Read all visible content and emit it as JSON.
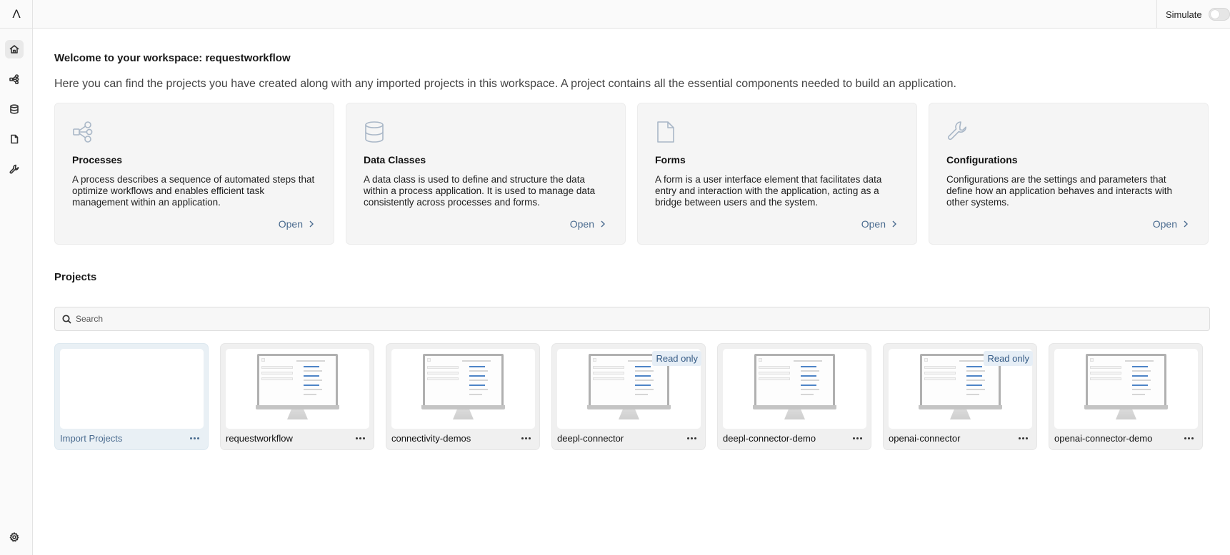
{
  "app": {
    "logo": "Λ"
  },
  "topbar": {
    "simulate_label": "Simulate",
    "simulate_on": false
  },
  "sidebar": {
    "items": [
      {
        "icon": "home-icon",
        "active": true
      },
      {
        "icon": "process-icon",
        "active": false
      },
      {
        "icon": "database-icon",
        "active": false
      },
      {
        "icon": "file-icon",
        "active": false
      },
      {
        "icon": "wrench-icon",
        "active": false
      }
    ],
    "settings_icon": "gear-icon"
  },
  "main": {
    "welcome": "Welcome to your workspace: requestworkflow",
    "intro": "Here you can find the projects you have created along with any imported projects in this workspace. A project contains all the essential components needed to build an application.",
    "cards": [
      {
        "icon": "process-icon",
        "title": "Processes",
        "description": "A process describes a sequence of automated steps that optimize workflows and enables efficient task management within an application.",
        "open": "Open"
      },
      {
        "icon": "database-icon",
        "title": "Data Classes",
        "description": "A data class is used to define and structure the data within a process application. It is used to manage data consistently across processes and forms.",
        "open": "Open"
      },
      {
        "icon": "file-icon",
        "title": "Forms",
        "description": "A form is a user interface element that facilitates data entry and interaction with the application, acting as a bridge between users and the system.",
        "open": "Open"
      },
      {
        "icon": "wrench-icon",
        "title": "Configurations",
        "description": "Configurations are the settings and parameters that define how an application behaves and interacts with other systems.",
        "open": "Open"
      }
    ],
    "projects_title": "Projects",
    "search": {
      "placeholder": "Search",
      "value": ""
    },
    "projects": [
      {
        "name": "Import Projects",
        "type": "import",
        "badge": ""
      },
      {
        "name": "requestworkflow",
        "type": "project",
        "badge": ""
      },
      {
        "name": "connectivity-demos",
        "type": "project",
        "badge": ""
      },
      {
        "name": "deepl-connector",
        "type": "project",
        "badge": "Read only"
      },
      {
        "name": "deepl-connector-demo",
        "type": "project",
        "badge": ""
      },
      {
        "name": "openai-connector",
        "type": "project",
        "badge": "Read only"
      },
      {
        "name": "openai-connector-demo",
        "type": "project",
        "badge": ""
      }
    ]
  }
}
